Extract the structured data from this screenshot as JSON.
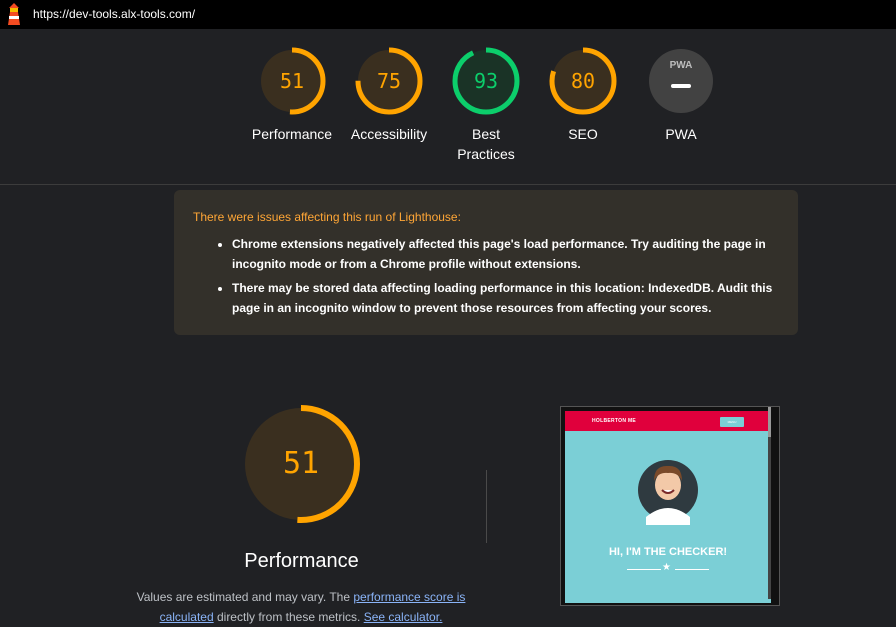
{
  "browser": {
    "url": "https://dev-tools.alx-tools.com/"
  },
  "scores": [
    {
      "id": "performance",
      "label": "Performance",
      "score": 51,
      "color": "#ffa400",
      "bg": "#3a2f1f"
    },
    {
      "id": "accessibility",
      "label": "Accessibility",
      "score": 75,
      "color": "#ffa400",
      "bg": "#3a2f1f"
    },
    {
      "id": "best-practices",
      "label": "Best Practices",
      "score": 93,
      "color": "#0cce6b",
      "bg": "#1a3326"
    },
    {
      "id": "seo",
      "label": "SEO",
      "score": 80,
      "color": "#ffa400",
      "bg": "#3a2f1f"
    },
    {
      "id": "pwa",
      "label": "PWA",
      "score": null,
      "badge": "PWA",
      "color": "#9aa0a6",
      "bg": "#424242"
    }
  ],
  "warning": {
    "title": "There were issues affecting this run of Lighthouse:",
    "items": [
      "Chrome extensions negatively affected this page's load performance. Try auditing the page in incognito mode or from a Chrome profile without extensions.",
      "There may be stored data affecting loading performance in this location: IndexedDB. Audit this page in an incognito window to prevent those resources from affecting your scores."
    ]
  },
  "performance": {
    "score": 51,
    "title": "Performance",
    "note_prefix": "Values are estimated and may vary. The ",
    "note_link1": "performance score is calculated",
    "note_middle": " directly from these metrics. ",
    "note_link2": "See calculator."
  },
  "screenshot": {
    "brand": "HOLBERTON ME",
    "button": "MENU",
    "headline": "HI, I'M THE CHECKER!",
    "accent": "#e0003c",
    "background": "#7bcfd6"
  }
}
